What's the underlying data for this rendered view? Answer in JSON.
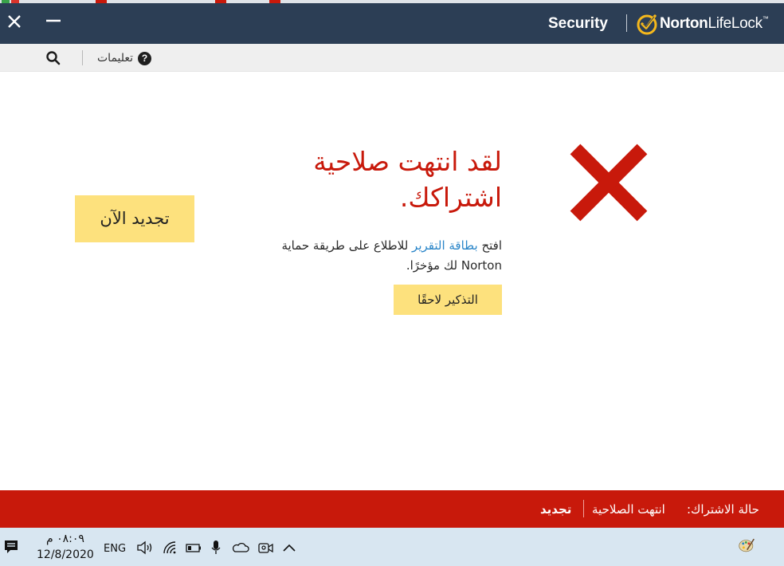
{
  "colors": {
    "titlebar": "#2c3e55",
    "accent_red": "#c8190b",
    "button_yellow": "#fde17d",
    "link_blue": "#2b86c9",
    "taskbar": "#d8e6f1",
    "norton_yellow": "#f5b81c"
  },
  "titlebar": {
    "title": "Security",
    "logo_bold": "Norton",
    "logo_regular": "LifeLock",
    "logo_tm": "™",
    "close_icon": "close-icon",
    "minimize_icon": "minimize-icon"
  },
  "toolbar": {
    "help_label": "تعليمات",
    "help_icon_glyph": "?",
    "search_icon": "search-icon"
  },
  "main": {
    "headline_line1": "لقد انتهت صلاحية",
    "headline_line2": "اشتراكك.",
    "desc_before": "افتح ",
    "desc_link": "بطاقة التقرير",
    "desc_after": " للاطلاع على طريقة حماية Norton لك مؤخرًا.",
    "renew_now_label": "تجديد الآن",
    "remind_later_label": "التذكير لاحقًا",
    "status_icon": "expired-x-icon"
  },
  "statusbar": {
    "label": "حالة الاشتراك:",
    "value": "انتهت الصلاحية",
    "renew_label": "تجديد"
  },
  "taskbar": {
    "time": "٠٨:٠٩ م",
    "date": "12/8/2020",
    "language": "ENG",
    "icons": [
      "notification-icon",
      "volume-icon",
      "wifi-icon",
      "battery-icon",
      "microphone-icon",
      "onedrive-icon",
      "meet-now-icon",
      "chevron-up-icon",
      "paint-palette-icon"
    ]
  }
}
